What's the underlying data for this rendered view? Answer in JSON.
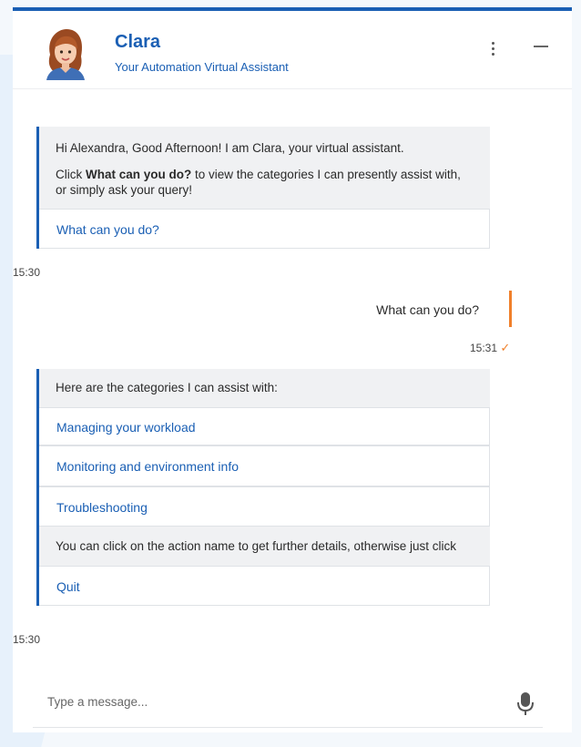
{
  "header": {
    "name": "Clara",
    "subtitle": "Your Automation Virtual Assistant"
  },
  "messages": {
    "greeting": {
      "line1": "Hi Alexandra, Good Afternoon! I am Clara, your virtual assistant.",
      "line2_pre": "Click ",
      "line2_bold": "What can you do?",
      "line2_post": " to view the categories I can presently assist with, or simply ask your query!",
      "option": "What can you do?",
      "time": "15:30"
    },
    "user": {
      "text": "What can you do?",
      "time": "15:31",
      "check": "✓"
    },
    "categories": {
      "intro": "Here are the categories I can assist with:",
      "options": [
        "Managing your workload",
        "Monitoring and environment info",
        "Troubleshooting"
      ],
      "note": "You can click on the action name to get further details, otherwise just click",
      "quit": "Quit",
      "time": "15:30"
    }
  },
  "composer": {
    "placeholder": "Type a message..."
  }
}
